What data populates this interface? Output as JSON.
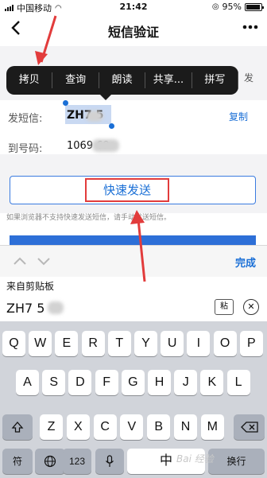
{
  "status": {
    "carrier": "中国移动",
    "time": "21:42",
    "battery": "95%",
    "battery_level": 0.95
  },
  "nav": {
    "back_icon": "chevron-left",
    "title": "短信验证",
    "more_icon": "ellipsis"
  },
  "context_menu": {
    "items": [
      "拷贝",
      "查询",
      "朗读",
      "共享...",
      "拼写"
    ]
  },
  "behind_menu_text": "发",
  "sms_row": {
    "label": "发短信:",
    "code": "ZH7   5",
    "copy_label": "复制"
  },
  "to_row": {
    "label": "到号码:",
    "number": "1069        69"
  },
  "send_button": {
    "label": "快速发送"
  },
  "hint": "如果浏览器不支持快速发送短信，请手动发送短信。",
  "keyboard_toolbar": {
    "done_label": "完成"
  },
  "clipboard": {
    "label": "来自剪贴板",
    "code": "ZH7  5",
    "icon_text": "粘"
  },
  "keyboard": {
    "row1": [
      "Q",
      "W",
      "E",
      "R",
      "T",
      "Y",
      "U",
      "I",
      "O",
      "P"
    ],
    "row2": [
      "A",
      "S",
      "D",
      "F",
      "G",
      "H",
      "J",
      "K",
      "L"
    ],
    "row3": [
      "Z",
      "X",
      "C",
      "V",
      "B",
      "N",
      "M"
    ],
    "symbols_label": "符",
    "numbers_label": "123",
    "space_label": "中",
    "return_label": "换行"
  },
  "watermark": "Bai 经验",
  "colors": {
    "accent_blue": "#1a6fd6",
    "highlight_red": "#e23c3c",
    "menu_bg": "#1b1b1b"
  }
}
